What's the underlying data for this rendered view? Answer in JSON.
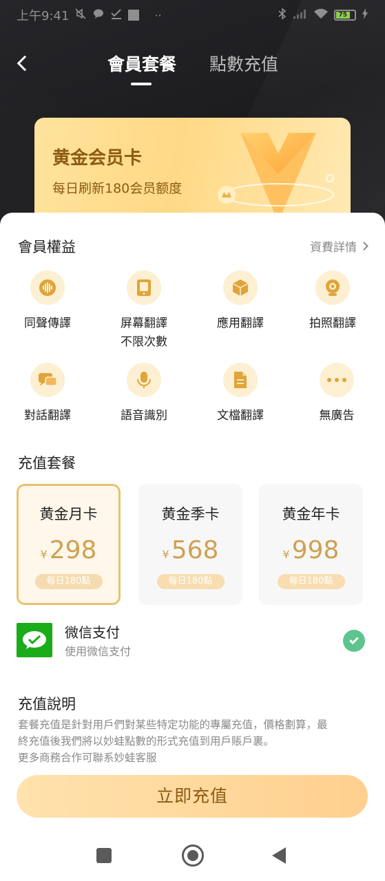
{
  "status_bar": {
    "time": "上午9:41",
    "battery": "75",
    "icons": [
      "mute-icon",
      "chat-icon",
      "check-icon",
      "square-icon",
      "dots-icon",
      "bluetooth-icon",
      "signal-icon",
      "wifi-icon",
      "battery-icon",
      "charging-icon"
    ]
  },
  "nav": {
    "back_icon": "chevron-left-icon",
    "tabs": [
      {
        "label": "會員套餐",
        "active": true
      },
      {
        "label": "點數充值",
        "active": false
      }
    ]
  },
  "gold_card": {
    "title": "黄金会员卡",
    "subtitle": "每日刷新180会员额度"
  },
  "rights": {
    "title": "會員權益",
    "fee_link": "資費詳情",
    "features": [
      {
        "icon": "sound-wave-icon",
        "label": "同聲傳譯"
      },
      {
        "icon": "screen-icon",
        "label_line1": "屏幕翻譯",
        "label_line2": "不限次數"
      },
      {
        "icon": "app-box-icon",
        "label": "應用翻譯"
      },
      {
        "icon": "camera-icon",
        "label": "拍照翻譯"
      },
      {
        "icon": "dialog-icon",
        "label": "對話翻譯"
      },
      {
        "icon": "microphone-icon",
        "label": "語音識別"
      },
      {
        "icon": "document-icon",
        "label": "文檔翻譯"
      },
      {
        "icon": "more-dots-icon",
        "label": "無廣告"
      }
    ]
  },
  "plans": {
    "title": "充值套餐",
    "items": [
      {
        "name": "黄金月卡",
        "currency": "¥",
        "price": "298",
        "badge": "每日180點",
        "selected": true
      },
      {
        "name": "黄金季卡",
        "currency": "¥",
        "price": "568",
        "badge": "每日180點",
        "selected": false
      },
      {
        "name": "黄金年卡",
        "currency": "¥",
        "price": "998",
        "badge": "每日180點",
        "selected": false
      }
    ]
  },
  "payment": {
    "icon": "wechat-icon",
    "title": "微信支付",
    "subtitle": "使用微信支付",
    "selected": true
  },
  "description": {
    "title": "充值說明",
    "line1": "套餐充值是針對用戶們對某些特定功能的專屬充值，價格劃算，最",
    "line2": "終充值後我們將以妙蛙點數的形式充值到用戶賬戶裏。",
    "line3": "更多商務合作可聯系妙蛙客服"
  },
  "cta": {
    "label": "立即充值"
  },
  "colors": {
    "gold_text": "#8c5a12",
    "price": "#cfa051",
    "wechat": "#1aad19",
    "check": "#5cc48d",
    "icon_bg": "#fdefd2",
    "icon_fg": "#e0a43a"
  }
}
